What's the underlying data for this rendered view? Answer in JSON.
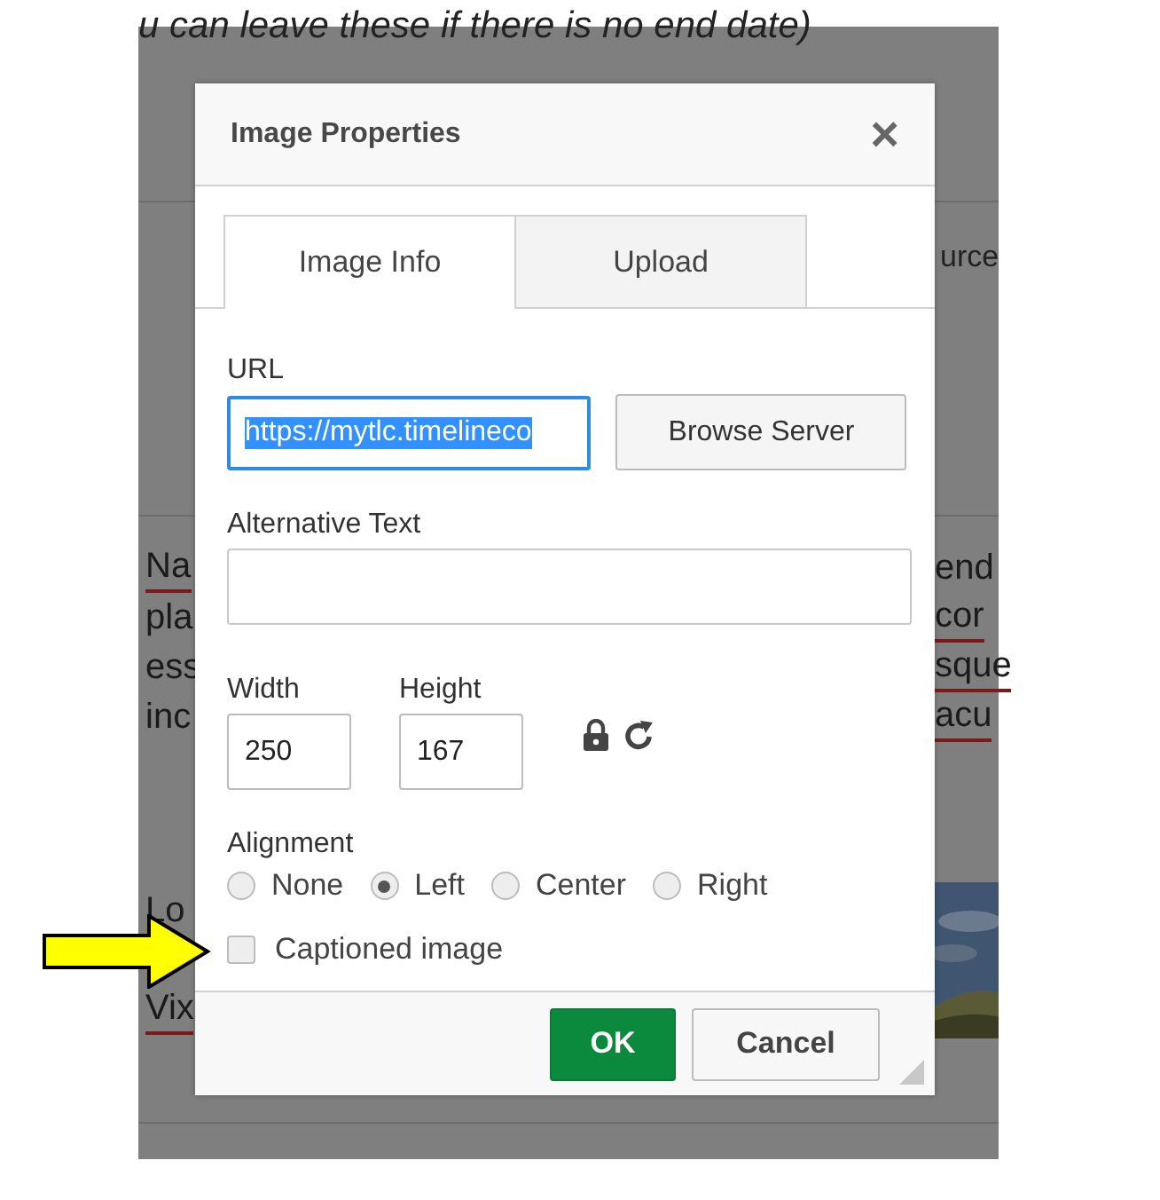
{
  "background": {
    "heading_fragment": "u can leave these if there is no end date)",
    "toolbar_fragment": "urce",
    "left_fragments": [
      {
        "text": "Na",
        "underlined": true
      },
      {
        "text": "pla",
        "underlined": false
      },
      {
        "text": "ess",
        "underlined": false
      },
      {
        "text": "inc",
        "underlined": false
      }
    ],
    "right_fragments": [
      {
        "text": "end",
        "underlined": false
      },
      {
        "text": "cor",
        "underlined": true
      },
      {
        "text": "sque",
        "underlined": true
      },
      {
        "text": "acu",
        "underlined": true
      }
    ],
    "lower_fragments": [
      {
        "text": "Lo",
        "underlined": false
      },
      {
        "text": "Vix",
        "underlined": true
      }
    ]
  },
  "dialog": {
    "title": "Image Properties",
    "close": "×",
    "tabs": [
      {
        "label": "Image Info",
        "selected": true
      },
      {
        "label": "Upload",
        "selected": false
      }
    ],
    "url": {
      "label": "URL",
      "value": "https://mytlc.timelineco",
      "selected_text": true
    },
    "browse_button": "Browse Server",
    "alt_text": {
      "label": "Alternative Text"
    },
    "width": {
      "label": "Width",
      "value": "250"
    },
    "height": {
      "label": "Height",
      "value": "167"
    },
    "alignment": {
      "label": "Alignment",
      "options": [
        {
          "label": "None",
          "selected": false
        },
        {
          "label": "Left",
          "selected": true
        },
        {
          "label": "Center",
          "selected": false
        },
        {
          "label": "Right",
          "selected": false
        }
      ]
    },
    "captioned": {
      "label": "Captioned image",
      "checked": false
    },
    "buttons": [
      {
        "label": "OK",
        "kind": "primary"
      },
      {
        "label": "Cancel",
        "kind": "secondary"
      }
    ]
  },
  "annotation": {
    "kind": "arrow"
  }
}
